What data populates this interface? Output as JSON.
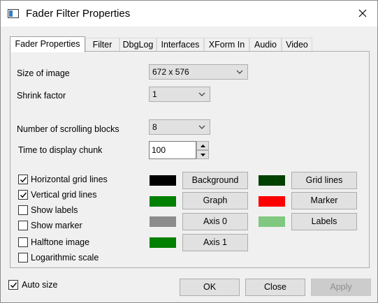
{
  "window": {
    "title": "Fader Filter Properties"
  },
  "tabs": [
    {
      "label": "Fader Properties",
      "active": true
    },
    {
      "label": "Filter"
    },
    {
      "label": "DbgLog"
    },
    {
      "label": "Interfaces"
    },
    {
      "label": "XForm In"
    },
    {
      "label": "Audio"
    },
    {
      "label": "Video"
    }
  ],
  "settings": {
    "size_label": "Size of image",
    "size_value": "672 x 576",
    "shrink_label": "Shrink factor",
    "shrink_value": "1",
    "blocks_label": "Number of scrolling blocks",
    "blocks_value": "8",
    "time_label": "Time to display chunk",
    "time_value": "100"
  },
  "checkboxes": [
    {
      "label": "Horizontal grid lines",
      "checked": true
    },
    {
      "label": "Vertical grid lines",
      "checked": true
    },
    {
      "label": "Show labels",
      "checked": false
    },
    {
      "label": "Show marker",
      "checked": false
    },
    {
      "label": "Halftone image",
      "checked": false
    },
    {
      "label": "Logarithmic scale",
      "checked": false
    }
  ],
  "colors": [
    {
      "label": "Background",
      "color": "#000000"
    },
    {
      "label": "Graph",
      "color": "#008000"
    },
    {
      "label": "Axis 0",
      "color": "#8c8c8c"
    },
    {
      "label": "Axis 1",
      "color": "#008000"
    },
    {
      "label": "Grid lines",
      "color": "#004000"
    },
    {
      "label": "Marker",
      "color": "#ff0000"
    },
    {
      "label": "Labels",
      "color": "#80c880"
    }
  ],
  "footer": {
    "auto_size_label": "Auto size",
    "auto_size_checked": true,
    "ok_label": "OK",
    "close_label": "Close",
    "apply_label": "Apply",
    "apply_enabled": false
  }
}
